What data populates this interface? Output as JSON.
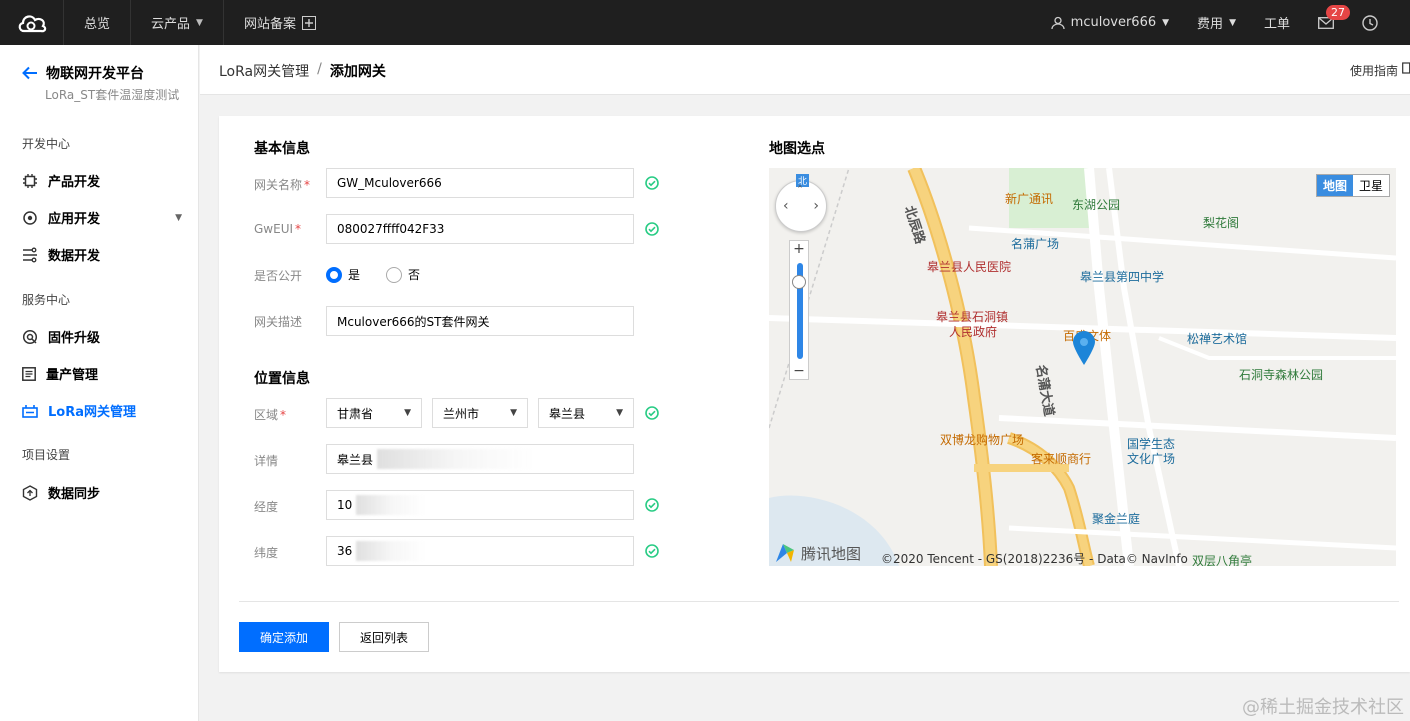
{
  "topbar": {
    "nav": [
      "总览",
      "云产品",
      "网站备案"
    ],
    "user": "mculover666",
    "billing": "费用",
    "ticket": "工单",
    "mail_badge": "27"
  },
  "sidebar": {
    "platform_title": "物联网开发平台",
    "platform_sub": "LoRa_ST套件温湿度测试",
    "sections": {
      "dev": "开发中心",
      "service": "服务中心",
      "project": "项目设置"
    },
    "items": {
      "product": "产品开发",
      "app": "应用开发",
      "data": "数据开发",
      "firmware": "固件升级",
      "mass": "量产管理",
      "lora": "LoRa网关管理",
      "sync": "数据同步"
    }
  },
  "header": {
    "crumb_parent": "LoRa网关管理",
    "crumb_sep": "/",
    "crumb_current": "添加网关",
    "guide": "使用指南"
  },
  "form": {
    "basic_title": "基本信息",
    "location_title": "位置信息",
    "labels": {
      "name": "网关名称",
      "gweui": "GwEUI",
      "public": "是否公开",
      "desc": "网关描述",
      "region": "区域",
      "detail": "详情",
      "lng": "经度",
      "lat": "纬度"
    },
    "required_mark": "*",
    "values": {
      "name": "GW_Mculover666",
      "gweui": "080027ffff042F33",
      "desc": "Mculover666的ST套件网关",
      "province": "甘肃省",
      "city": "兰州市",
      "county": "皋兰县",
      "detail": "皋兰县",
      "lng": "10",
      "lat": "36"
    },
    "radio_yes": "是",
    "radio_no": "否",
    "confirm": "确定添加",
    "back": "返回列表"
  },
  "map": {
    "title": "地图选点",
    "toggle_map": "地图",
    "toggle_sat": "卫星",
    "brand": "腾讯地图",
    "copyright": "©2020 Tencent - GS(2018)2236号 - Data© NavInfo",
    "labels": {
      "xinguang": "新广通讯",
      "donghu": "东湖公园",
      "lihua": "梨花阁",
      "mingpu_sq": "名蒲广场",
      "hospital": "皋兰县人民医院",
      "school": "皋兰县第四中学",
      "gov1": "皋兰县石洞镇",
      "gov2": "人民政府",
      "baisheng": "百盛文体",
      "songchan": "松禅艺术馆",
      "shidong": "石洞寺森林公园",
      "shuangbo": "双博龙购物广场",
      "kelai": "客来顺商行",
      "guoxue1": "国学生态",
      "guoxue2": "文化广场",
      "jujin": "聚金兰庭",
      "bajiao": "双层八角亭",
      "beichen": "北辰路",
      "mingpu_dd": "名蒲大道"
    }
  },
  "watermark": "@稀土掘金技术社区",
  "colors": {
    "accent": "#006eff",
    "success": "#29cc85",
    "topbar": "#1f1f1f"
  }
}
